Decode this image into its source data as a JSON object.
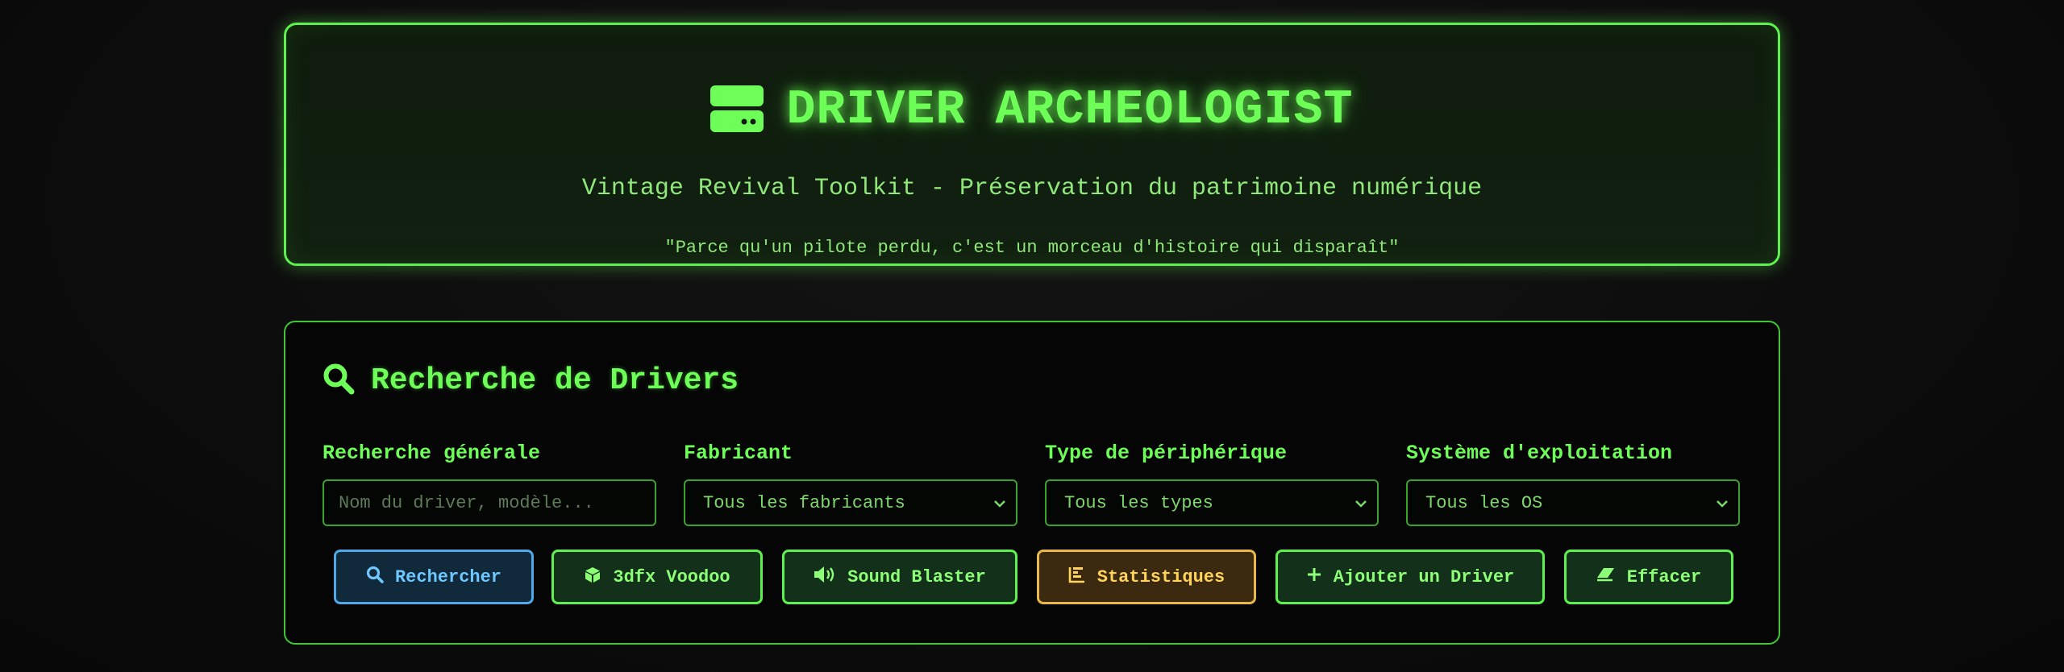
{
  "header": {
    "title": "DRIVER ARCHEOLOGIST",
    "subtitle": "Vintage Revival Toolkit - Préservation du patrimoine numérique",
    "quote": "\"Parce qu'un pilote perdu, c'est un morceau d'histoire qui disparaît\"",
    "icon": "server-icon"
  },
  "search": {
    "title": "Recherche de Drivers",
    "icon": "search-icon",
    "fields": {
      "general": {
        "label": "Recherche générale",
        "placeholder": "Nom du driver, modèle..."
      },
      "manufacturer": {
        "label": "Fabricant",
        "value": "Tous les fabricants"
      },
      "device_type": {
        "label": "Type de périphérique",
        "value": "Tous les types"
      },
      "os": {
        "label": "Système d'exploitation",
        "value": "Tous les OS"
      }
    },
    "buttons": {
      "search": "Rechercher",
      "voodoo": "3dfx Voodoo",
      "soundblaster": "Sound Blaster",
      "stats": "Statistiques",
      "add": "Ajouter un Driver",
      "clear": "Effacer"
    }
  },
  "colors": {
    "accent": "#5ef04e",
    "background": "#0b0b0b",
    "blue": "#4fa8e8",
    "amber": "#e8b84a"
  }
}
